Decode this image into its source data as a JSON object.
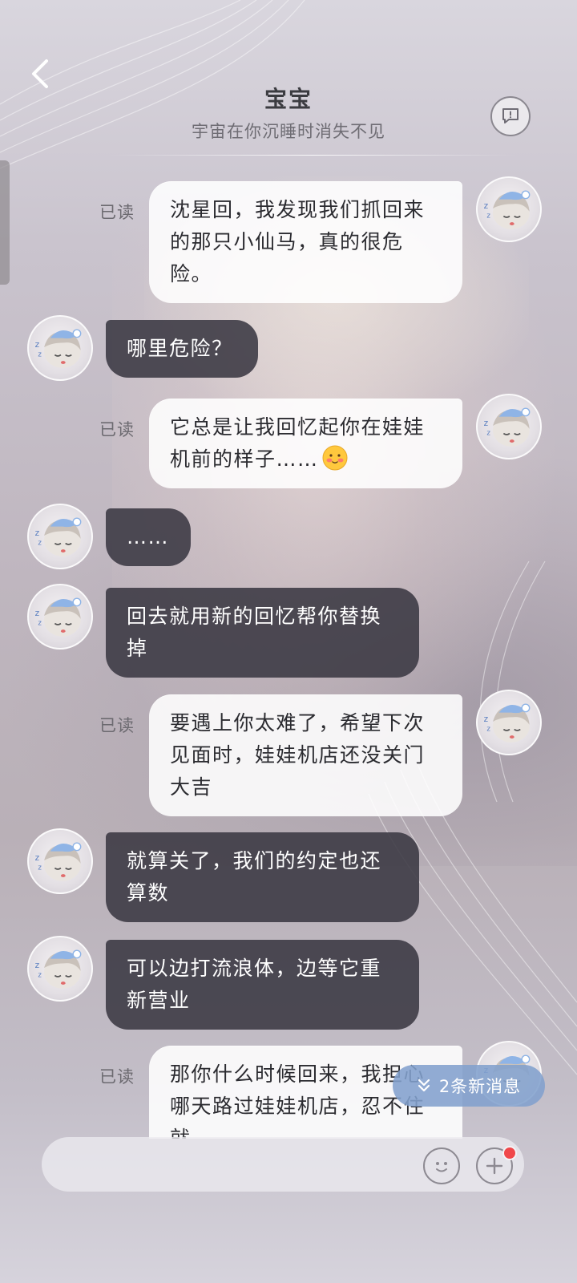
{
  "header": {
    "title": "宝宝",
    "subtitle": "宇宙在你沉睡时消失不见",
    "icons": {
      "back": "chevron-left-icon",
      "dialog": "chat-bubble-icon"
    }
  },
  "messages": [
    {
      "sender": "me",
      "read_label": "已读",
      "text_lines": [
        "沈星回，我发现我们抓回来",
        "的那只小仙马，真的很危",
        "险。"
      ]
    },
    {
      "sender": "them",
      "text_lines": [
        "哪里危险？"
      ]
    },
    {
      "sender": "me",
      "read_label": "已读",
      "text_lines": [
        "它总是让我回忆起你在娃娃",
        "机前的样子……"
      ],
      "emoji": "blushing-face-emoji"
    },
    {
      "sender": "them",
      "text_lines": [
        "……"
      ]
    },
    {
      "sender": "them",
      "text_lines": [
        "回去就用新的回忆帮你替换",
        "掉"
      ]
    },
    {
      "sender": "me",
      "read_label": "已读",
      "text_lines": [
        "要遇上你太难了，希望下次",
        "见面时，娃娃机店还没关门",
        "大吉"
      ]
    },
    {
      "sender": "them",
      "text_lines": [
        "就算关了，我们的约定也还",
        "算数"
      ]
    },
    {
      "sender": "them",
      "text_lines": [
        "可以边打流浪体，边等它重",
        "新营业"
      ]
    },
    {
      "sender": "me",
      "read_label": "已读",
      "text_lines": [
        "那你什么时候回来，我担心",
        "哪天路过娃娃机店，忍不住",
        "就……"
      ]
    }
  ],
  "new_messages_pill": {
    "label": "2条新消息",
    "icon": "double-chevron-down-icon"
  },
  "input_bar": {
    "placeholder": "",
    "icons": {
      "emoji": "smiley-icon",
      "plus": "plus-icon"
    },
    "notification_dot_color": "#f0474a"
  },
  "colors": {
    "my_bubble": "#ffffff",
    "their_bubble": "#3a3842",
    "accent_pill": "#82a0cd"
  }
}
